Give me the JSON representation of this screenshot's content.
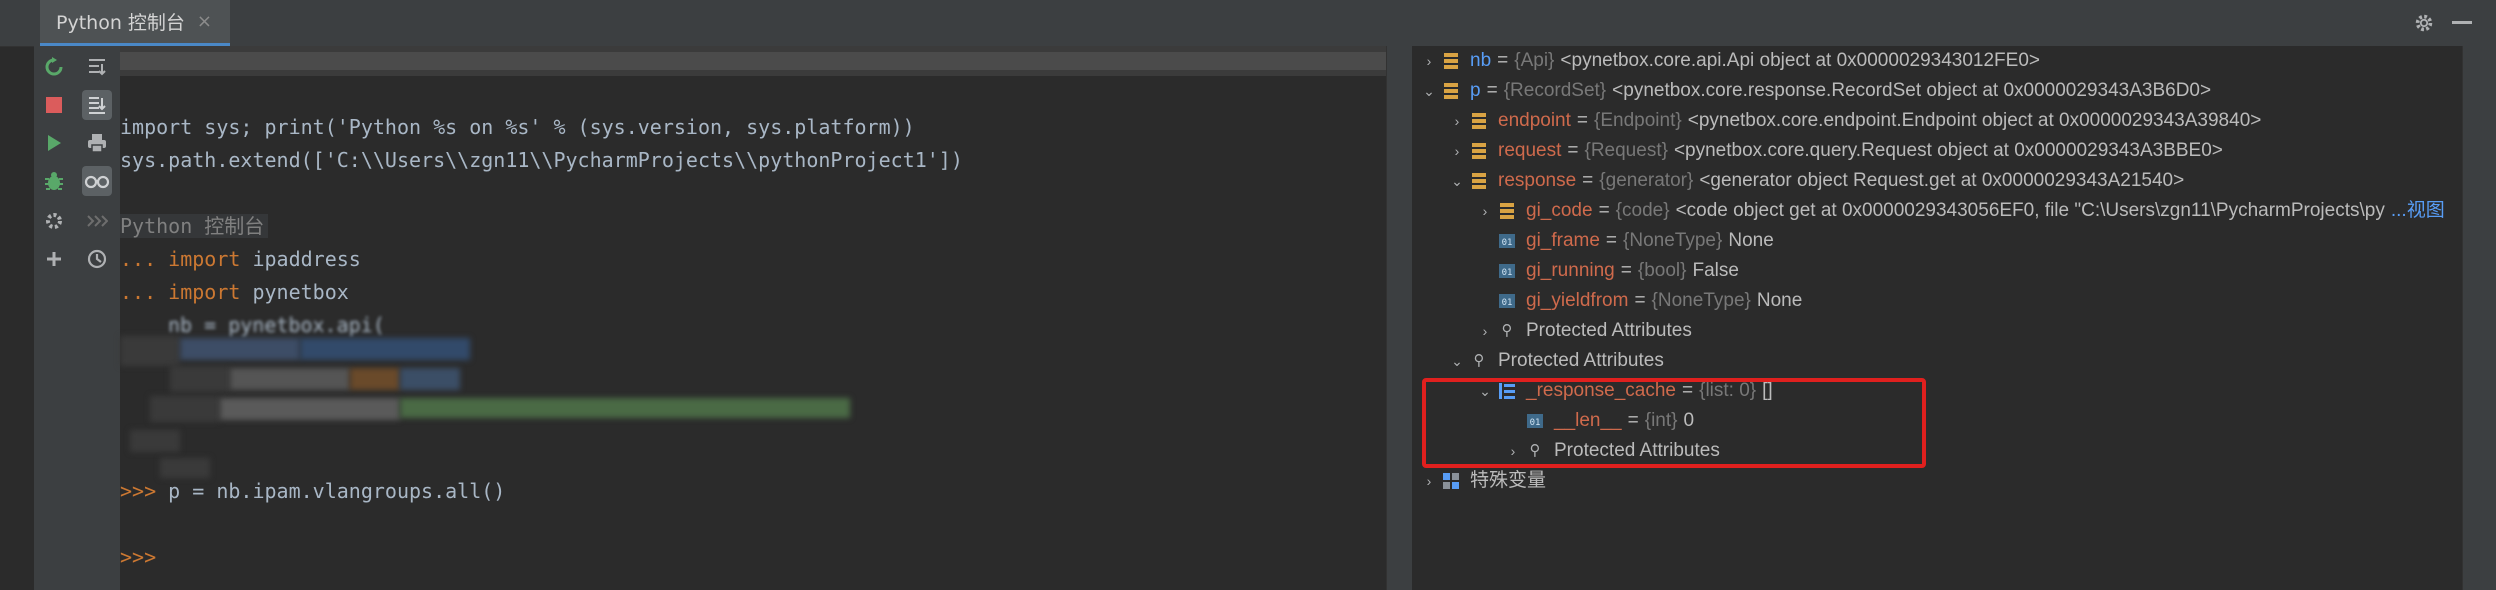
{
  "tab": {
    "title": "Python 控制台",
    "close": "×"
  },
  "console": {
    "lines": [
      "import sys; print('Python %s on %s' % (sys.version, sys.platform))",
      "sys.path.extend(['C:\\\\Users\\\\zgn11\\\\PycharmProjects\\\\pythonProject1'])",
      "Python 控制台",
      "import ipaddress",
      "import pynetbox",
      "nb = pynetbox.api(",
      "p = nb.ipam.vlangroups.all()"
    ],
    "prompt_cont": "...",
    "prompt_main": ">>>",
    "kw_import": "import",
    "ipaddress": " ipaddress",
    "pynetbox": " pynetbox"
  },
  "variables": {
    "nb": {
      "name": "nb",
      "type": "{Api}",
      "value": "<pynetbox.core.api.Api object at 0x0000029343012FE0>"
    },
    "p": {
      "name": "p",
      "type": "{RecordSet}",
      "value": "<pynetbox.core.response.RecordSet object at 0x0000029343A3B6D0>"
    },
    "endpoint": {
      "name": "endpoint",
      "type": "{Endpoint}",
      "value": "<pynetbox.core.endpoint.Endpoint object at 0x0000029343A39840>"
    },
    "request": {
      "name": "request",
      "type": "{Request}",
      "value": "<pynetbox.core.query.Request object at 0x0000029343A3BBE0>"
    },
    "response": {
      "name": "response",
      "type": "{generator}",
      "value": "<generator object Request.get at 0x0000029343A21540>"
    },
    "gi_code": {
      "name": "gi_code",
      "type": "{code}",
      "value": "<code object get at 0x0000029343056EF0, file \"C:\\Users\\zgn11\\PycharmProjects\\py",
      "more": "...视图"
    },
    "gi_frame": {
      "name": "gi_frame",
      "type": "{NoneType}",
      "value": "None"
    },
    "gi_running": {
      "name": "gi_running",
      "type": "{bool}",
      "value": "False"
    },
    "gi_yieldfrom": {
      "name": "gi_yieldfrom",
      "type": "{NoneType}",
      "value": "None"
    },
    "protected_inner": "Protected Attributes",
    "protected_p": "Protected Attributes",
    "response_cache": {
      "name": "_response_cache",
      "type": "{list: 0}",
      "value": "[]"
    },
    "len": {
      "name": "__len__",
      "type": "{int}",
      "value": "0"
    },
    "protected_cache": "Protected Attributes",
    "special": "特殊变量"
  },
  "colors": {
    "accent": "#4a88c7",
    "highlight": "#e0201e",
    "var_name": "#9876aa",
    "keyword": "#cc7832"
  }
}
